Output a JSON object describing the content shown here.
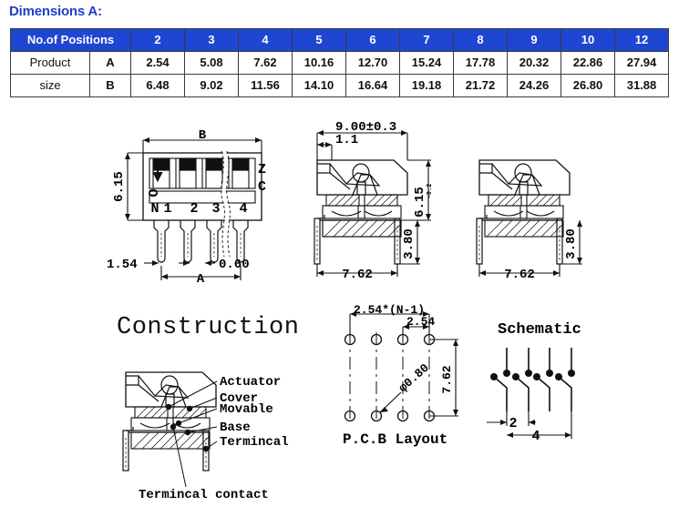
{
  "page": {
    "title": "Dimensions A:",
    "title_color": "#2040c8",
    "header_bg": "#1f46d2",
    "background": "#ffffff"
  },
  "table": {
    "row_header_label": "No.of Positions",
    "group_label_line1": "Product",
    "group_label_line2": "size",
    "positions": [
      "2",
      "3",
      "4",
      "5",
      "6",
      "7",
      "8",
      "9",
      "10",
      "12"
    ],
    "rows": [
      {
        "name": "A",
        "values": [
          "2.54",
          "5.08",
          "7.62",
          "10.16",
          "12.70",
          "15.24",
          "17.78",
          "20.32",
          "22.86",
          "27.94"
        ]
      },
      {
        "name": "B",
        "values": [
          "6.48",
          "9.02",
          "11.56",
          "14.10",
          "16.64",
          "19.18",
          "21.72",
          "24.26",
          "26.80",
          "31.88"
        ]
      }
    ]
  },
  "drawing_top_view": {
    "dim_b": "B",
    "dim_a": "A",
    "dim_height": "6.15",
    "dim_pin_offset": "1.54",
    "dim_pin_width": "0.60",
    "on_label_o": "O",
    "on_label_n": "N",
    "mark_z": "Z",
    "mark_c": "C",
    "positions": [
      "1",
      "2",
      "3",
      "4"
    ]
  },
  "drawing_side_view": {
    "dim_width": "9.00±0.3",
    "dim_lip": "1.1",
    "dim_height": "6.15",
    "dim_tolerance": "-0.2",
    "dim_lead_length": "3.80",
    "dim_lead_span": "7.62"
  },
  "drawing_side_view_2": {
    "dim_lead_length": "3.80",
    "dim_lead_span": "7.62"
  },
  "construction": {
    "title": "Construction",
    "labels": [
      "Actuator",
      "Cover",
      "Movable",
      "Base",
      "Termincal",
      "Termincal contact"
    ]
  },
  "pcb_layout": {
    "title": "P.C.B Layout",
    "dim_total": "2.54*(N-1)",
    "dim_pitch": "2.54",
    "dim_row_space": "7.62",
    "dim_hole": "φ0.80"
  },
  "schematic": {
    "title": "Schematic",
    "pin_label_left": "2",
    "pin_label_right": "4"
  }
}
